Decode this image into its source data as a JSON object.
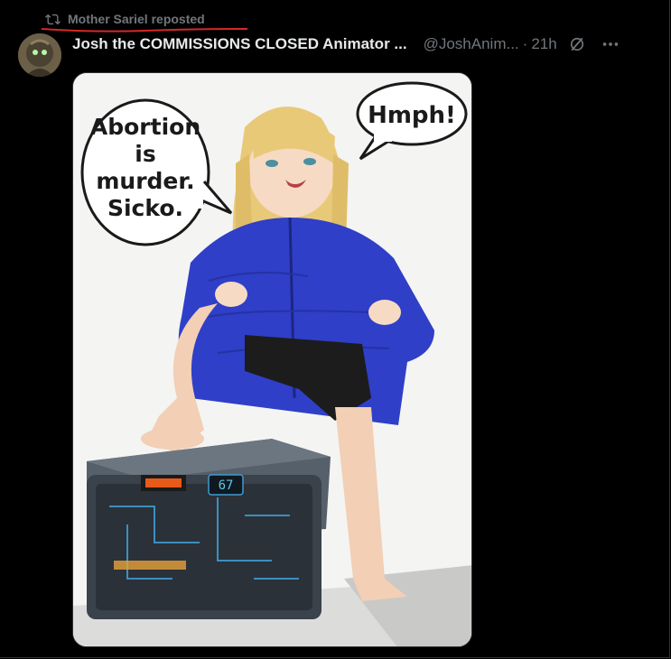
{
  "repost": {
    "label": "Mother Sariel reposted",
    "icon": "repost-icon"
  },
  "post": {
    "display_name": "Josh the COMMISSIONS CLOSED Animator ...",
    "handle": "@JoshAnim...",
    "separator": "·",
    "time": "21h",
    "grok_icon": "grok-icon",
    "more_icon": "more-icon"
  },
  "image": {
    "bubble_left": [
      "Abortion",
      "is",
      "murder.",
      "Sicko."
    ],
    "bubble_right": "Hmph!",
    "crate_number": "67"
  },
  "colors": {
    "background": "#000000",
    "muted": "#71767b",
    "text": "#e7e9ea",
    "annotation_red": "#d62828",
    "jacket_blue": "#2f3fc8"
  }
}
